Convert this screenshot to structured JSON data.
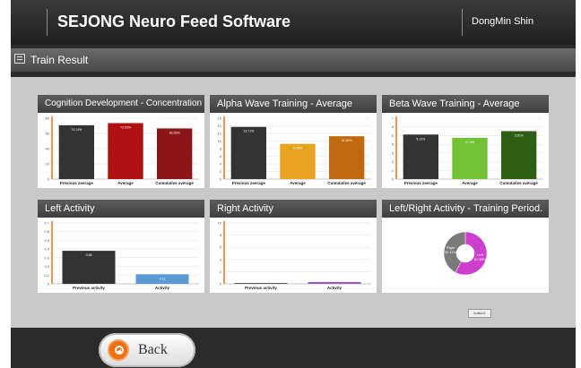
{
  "app": {
    "title": "SEJONG Neuro Feed Software",
    "user": "DongMin Shin"
  },
  "subheader": {
    "title": "Train Result"
  },
  "footer": {
    "back_label": "Back",
    "small_button_label": "button1"
  },
  "colors": {
    "accent": "#f07010",
    "panel_header": "#4a4a4a",
    "background": "#c9c9c9"
  },
  "chart_data": [
    {
      "type": "bar",
      "title": "Cognition Development - Concentration",
      "categories": [
        "Previous average",
        "Average",
        "Cumulative average"
      ],
      "values": [
        70.74,
        73.53,
        66.53
      ],
      "value_labels": [
        "70.74%",
        "73.53%",
        "66.53%"
      ],
      "colors": [
        "#333333",
        "#b01212",
        "#8c1515"
      ],
      "ylim": [
        0,
        80
      ],
      "yticks": [
        0,
        20,
        40,
        60,
        80
      ],
      "grid": true
    },
    {
      "type": "bar",
      "title": "Alpha Wave Training - Average",
      "categories": [
        "Previous average",
        "Average",
        "Cumulative average"
      ],
      "values": [
        13.71,
        9.25,
        11.26
      ],
      "value_labels": [
        "13.71%",
        "9.25%",
        "11.26%"
      ],
      "colors": [
        "#333333",
        "#e8a321",
        "#c06a10"
      ],
      "ylim": [
        0,
        16
      ],
      "yticks": [
        0,
        2,
        4,
        6,
        8,
        10,
        12,
        14,
        16
      ],
      "grid": true
    },
    {
      "type": "bar",
      "title": "Beta Wave Training - Average",
      "categories": [
        "Previous average",
        "Average",
        "Cumulative average"
      ],
      "values": [
        5.12,
        4.74,
        5.51
      ],
      "value_labels": [
        "5.12%",
        "4.74%",
        "5.51%"
      ],
      "colors": [
        "#333333",
        "#74c236",
        "#2f5e14"
      ],
      "ylim": [
        0,
        7
      ],
      "yticks": [
        0,
        1,
        2,
        3,
        4,
        5,
        6,
        7
      ],
      "grid": true
    },
    {
      "type": "bar",
      "title": "Left Activity",
      "categories": [
        "Previous activity",
        "Activity"
      ],
      "values": [
        0.38,
        0.11
      ],
      "value_labels": [
        "0.38",
        "0.11"
      ],
      "colors": [
        "#333333",
        "#5b9bd5"
      ],
      "ylim": [
        0,
        0.7
      ],
      "yticks": [
        0,
        0.1,
        0.2,
        0.3,
        0.4,
        0.5,
        0.6,
        0.7
      ],
      "grid": true
    },
    {
      "type": "bar",
      "title": "Right Activity",
      "categories": [
        "Previous activity",
        "Activity"
      ],
      "values": [
        0,
        0.3
      ],
      "value_labels": [],
      "colors": [
        "#333333",
        "#9b59b6"
      ],
      "ylim": [
        0,
        10
      ],
      "yticks": [
        0,
        2,
        4,
        6,
        8,
        10
      ],
      "grid": true
    },
    {
      "type": "pie",
      "title": "Left/Right Activity - Training Period.",
      "labels": [
        "Left",
        "Right"
      ],
      "values": [
        57.59,
        42.41
      ],
      "value_labels": [
        "57.59%",
        "42.41%"
      ],
      "colors": [
        "#cc3fcf",
        "#7a7a7a"
      ]
    }
  ]
}
